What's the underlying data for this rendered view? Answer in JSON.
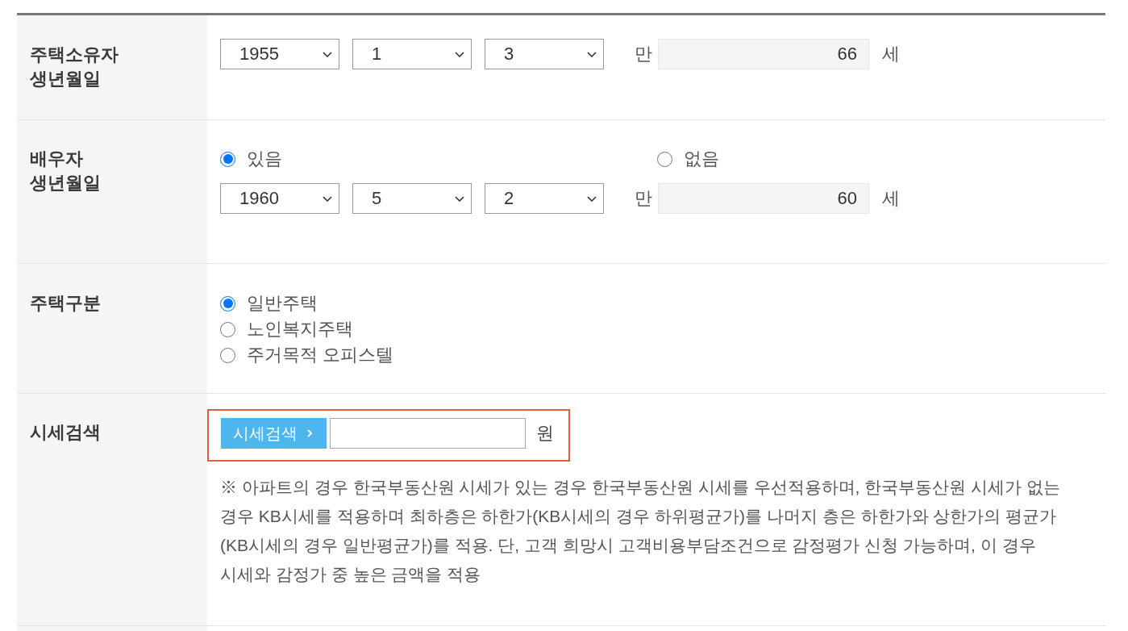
{
  "rows": [
    {
      "kind": "birthdate",
      "label": [
        "주택소유자",
        "생년월일"
      ],
      "year": "1955",
      "month": "1",
      "day": "3",
      "age_prefix": "만",
      "age": "66",
      "age_suffix": "세"
    },
    {
      "kind": "spouse_birthdate",
      "label": [
        "배우자",
        "생년월일"
      ],
      "options": [
        {
          "label": "있음",
          "selected": true
        },
        {
          "label": "없음",
          "selected": false
        }
      ],
      "year": "1960",
      "month": "5",
      "day": "2",
      "age_prefix": "만",
      "age": "60",
      "age_suffix": "세"
    },
    {
      "kind": "radio_list",
      "label": [
        "주택구분"
      ],
      "options": [
        {
          "label": "일반주택",
          "selected": true
        },
        {
          "label": "노인복지주택",
          "selected": false
        },
        {
          "label": "주거목적 오피스텔",
          "selected": false
        }
      ]
    },
    {
      "kind": "price_search",
      "label": [
        "시세검색"
      ],
      "highlighted": true,
      "button": "시세검색",
      "unit": "원",
      "note": "※ 아파트의 경우 한국부동산원 시세가 있는 경우 한국부동산원 시세를 우선적용하며, 한국부동산원 시세가 없는 경우 KB시세를 적용하며 최하층은 하한가(KB시세의 경우 하위평균가)를 나머지 층은 하한가와 상한가의 평균가(KB시세의 경우 일반평균가)를 적용. 단, 고객 희망시 고객비용부담조건으로 감정평가 신청 가능하며, 이 경우 시세와 감정가 중 높은 금액을 적용"
    }
  ]
}
